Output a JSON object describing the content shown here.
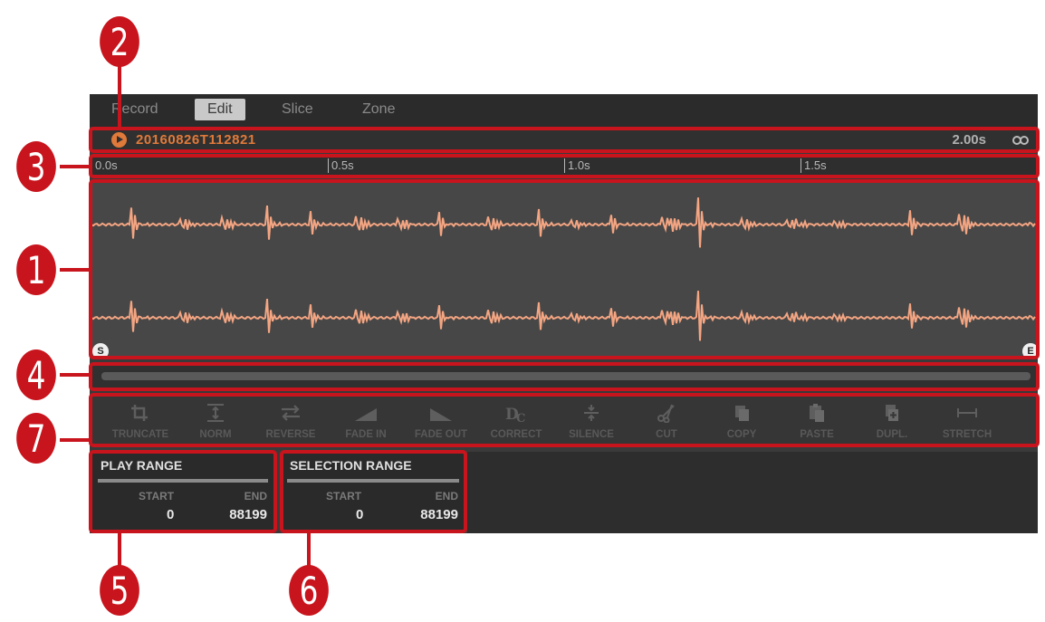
{
  "tabs": [
    "Record",
    "Edit",
    "Slice",
    "Zone"
  ],
  "active_tab": "Edit",
  "sample": {
    "name": "20160826T112821",
    "duration": "2.00s"
  },
  "timeline": {
    "ticks": [
      "0.0s",
      "0.5s",
      "1.0s",
      "1.5s"
    ]
  },
  "markers": {
    "start": "S",
    "end": "E"
  },
  "tools": [
    {
      "label": "TRUNCATE",
      "icon": "crop-icon"
    },
    {
      "label": "NORM",
      "icon": "normalize-icon"
    },
    {
      "label": "REVERSE",
      "icon": "reverse-icon"
    },
    {
      "label": "FADE IN",
      "icon": "fade-in-icon"
    },
    {
      "label": "FADE OUT",
      "icon": "fade-out-icon"
    },
    {
      "label": "CORRECT",
      "icon": "dc-correct-icon"
    },
    {
      "label": "SILENCE",
      "icon": "silence-icon"
    },
    {
      "label": "CUT",
      "icon": "scissors-icon"
    },
    {
      "label": "COPY",
      "icon": "copy-icon"
    },
    {
      "label": "PASTE",
      "icon": "paste-icon"
    },
    {
      "label": "DUPL.",
      "icon": "duplicate-icon"
    },
    {
      "label": "STRETCH",
      "icon": "stretch-icon"
    }
  ],
  "play_range": {
    "title": "PLAY RANGE",
    "start_label": "START",
    "end_label": "END",
    "start": "0",
    "end": "88199"
  },
  "selection_range": {
    "title": "SELECTION RANGE",
    "start_label": "START",
    "end_label": "END",
    "start": "0",
    "end": "88199"
  },
  "callouts": [
    "1",
    "2",
    "3",
    "4",
    "5",
    "6",
    "7"
  ],
  "colors": {
    "waveform": "#f4a582",
    "accent": "#e07a3a",
    "callout": "#c8141c"
  }
}
